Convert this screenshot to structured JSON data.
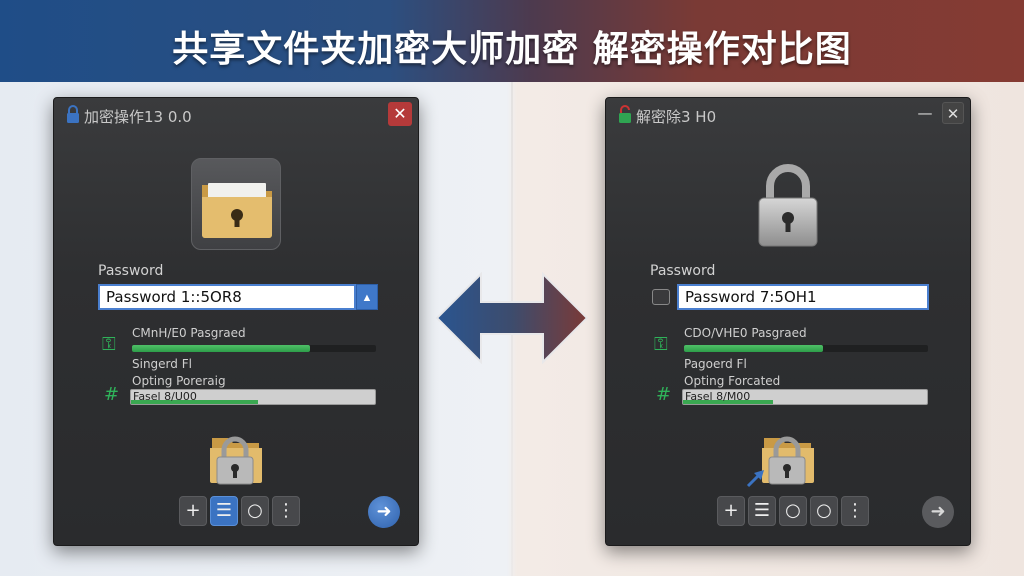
{
  "banner": {
    "title": "共享文件夹加密大师加密 解密操作对比图"
  },
  "left_window": {
    "title": "加密操作13 0.0",
    "close": "✕",
    "password_label": "Password",
    "password_value": "Password 1::5OR8",
    "spin": "▲",
    "status1": "CMnH/E0 Pasgraed",
    "progress1_fraction": 0.73,
    "status2": "Singerd Fl",
    "status3": "Opting Poreraig",
    "bar2_text": "Fasel 8/U00",
    "progress2_fraction": 0.52,
    "tools": [
      "+",
      "☰",
      "○",
      "⋮"
    ],
    "go": "➜"
  },
  "right_window": {
    "title": "解密除3 H0",
    "minimize": "—",
    "close": "✕",
    "password_label": "Password",
    "password_value": "Password 7:5OH1",
    "status1": "CDO/VHE0 Pasgraed",
    "progress1_fraction": 0.57,
    "status2": "Pagoerd Fl",
    "status3": "Opting Forcated",
    "bar2_text": "Fasel 8/M00",
    "progress2_fraction": 0.37,
    "tools": [
      "+",
      "☰",
      "○",
      "○",
      "⋮"
    ],
    "go": "➜"
  },
  "colors": {
    "banner_left": "#1f4d87",
    "banner_right": "#853b33",
    "accent_blue": "#3b73c2",
    "progress_green": "#2e9e4a",
    "close_red": "#b53a3a"
  },
  "icons": {
    "left_title": "lock-icon",
    "right_title": "unlock-icon",
    "left_hero": "folder-lock-icon",
    "right_hero": "padlock-icon",
    "compare": "double-arrow-icon"
  }
}
